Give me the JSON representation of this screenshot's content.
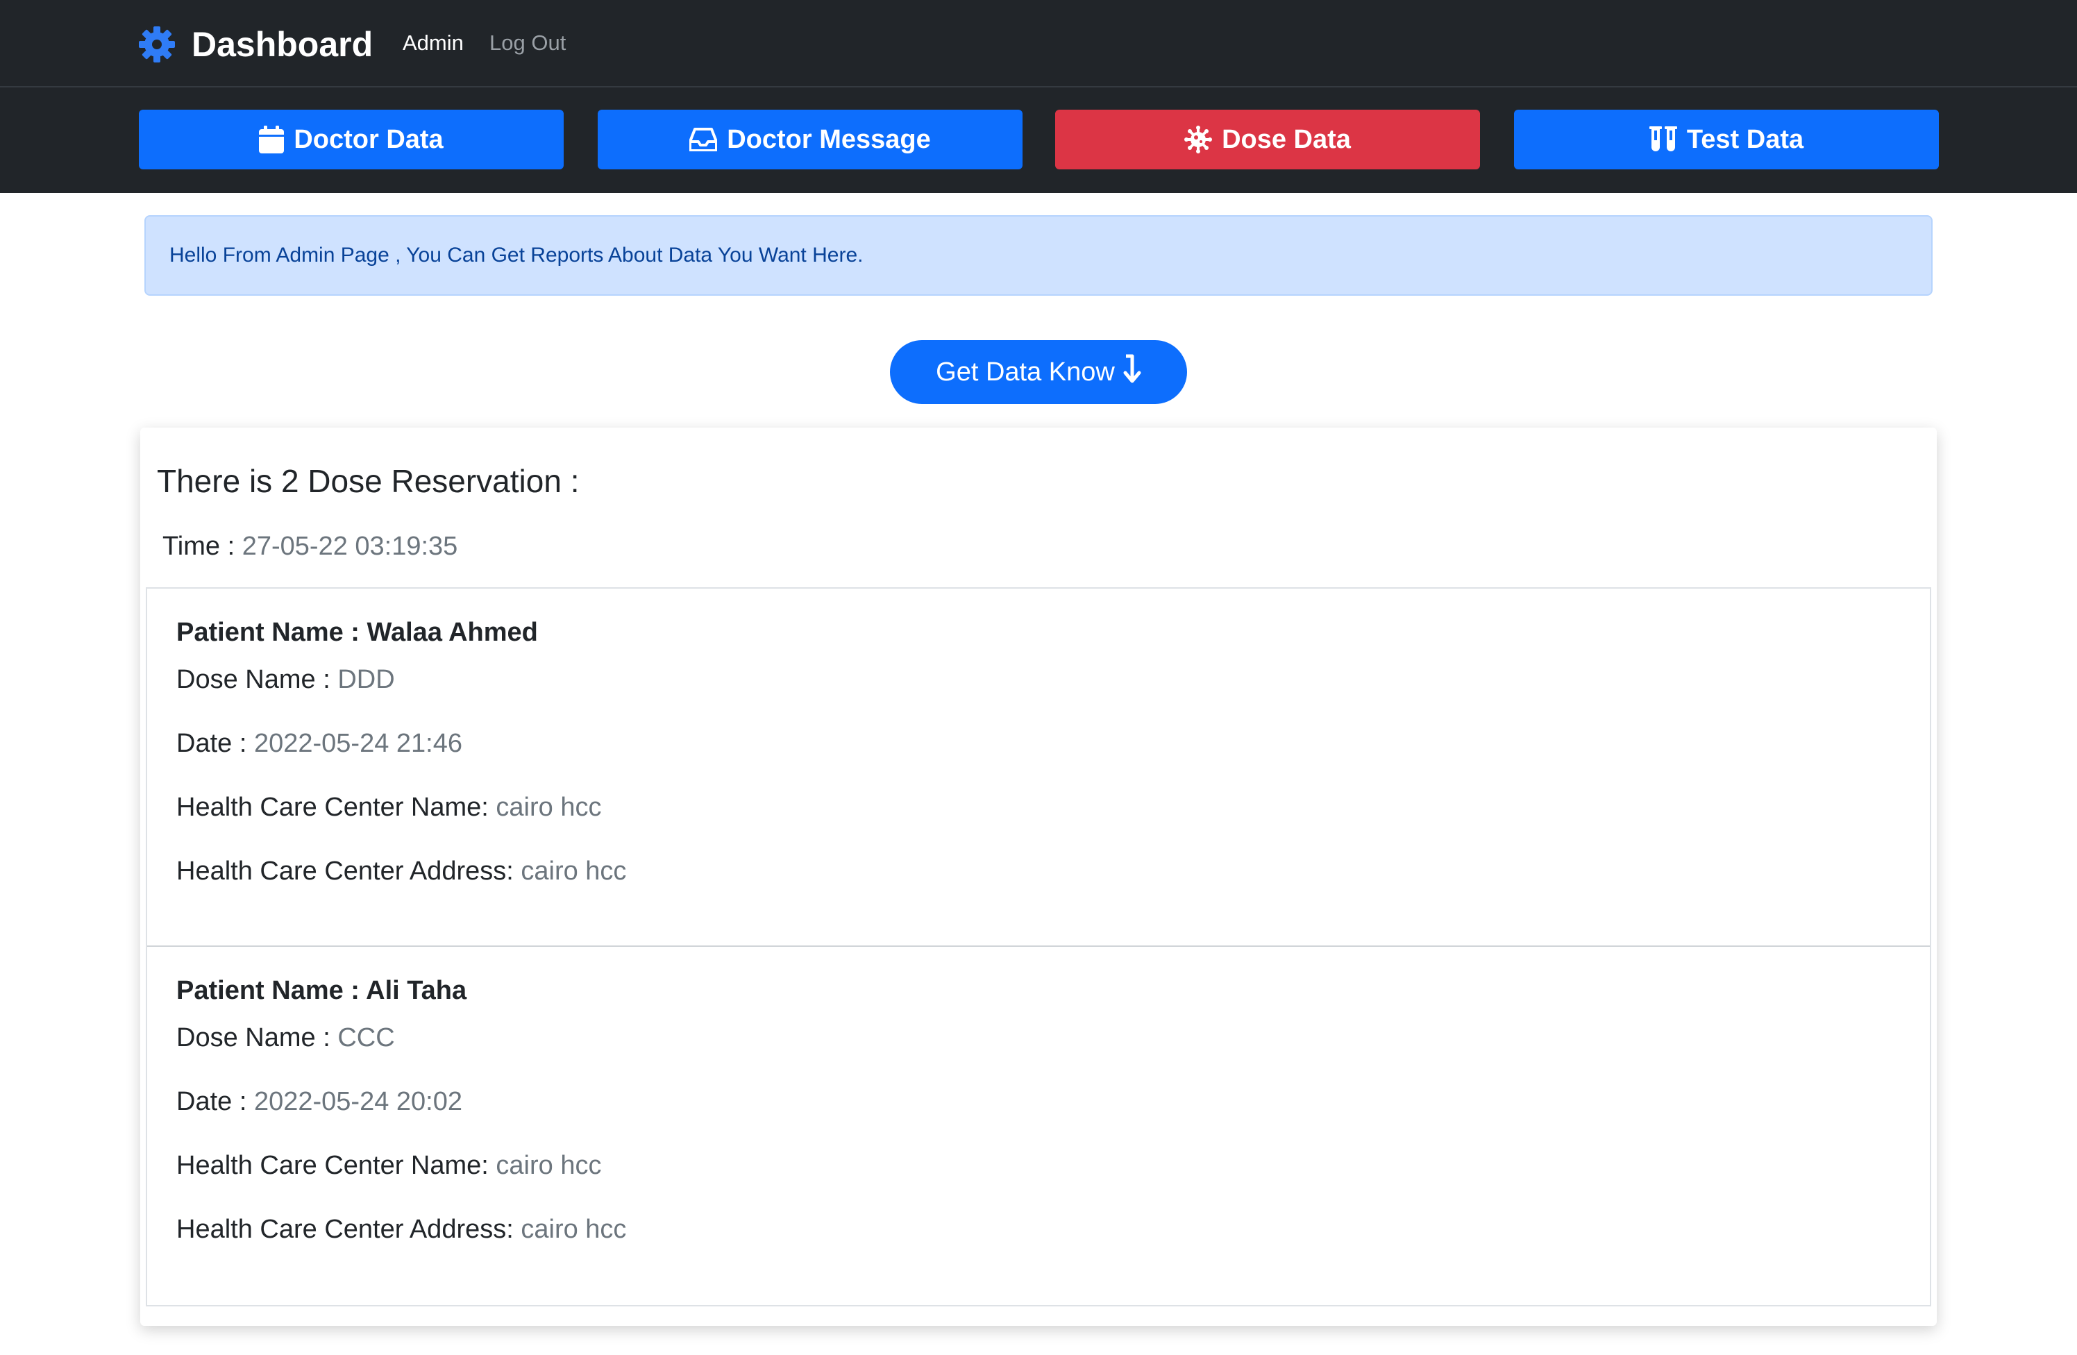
{
  "navbar": {
    "brand": "Dashboard",
    "brand_icon": "gear-icon",
    "links": [
      {
        "label": "Admin",
        "active": true
      },
      {
        "label": "Log Out",
        "active": false
      }
    ]
  },
  "actions": [
    {
      "label": "Doctor Data",
      "icon": "calendar-icon",
      "color": "#0d6efd"
    },
    {
      "label": "Doctor Message",
      "icon": "inbox-icon",
      "color": "#0d6efd"
    },
    {
      "label": "Dose Data",
      "icon": "virus-icon",
      "color": "#dc3545",
      "active": true
    },
    {
      "label": "Test Data",
      "icon": "test-tubes-icon",
      "color": "#0d6efd"
    }
  ],
  "alert": {
    "text": "Hello From Admin Page , You Can Get Reports About Data You Want Here."
  },
  "get_data": {
    "label": "Get Data Know",
    "icon": "arrow-down-icon"
  },
  "report": {
    "title": "There is 2 Dose Reservation :",
    "time_label": "Time :",
    "time_value": "27-05-22 03:19:35",
    "items": [
      {
        "patient_label": "Patient Name :",
        "patient_name": "Walaa Ahmed",
        "dose_label": "Dose Name :",
        "dose_name": "DDD",
        "date_label": "Date :",
        "date": "2022-05-24 21:46",
        "hcc_name_label": "Health Care Center Name:",
        "hcc_name": "cairo hcc",
        "hcc_address_label": "Health Care Center Address:",
        "hcc_address": "cairo hcc"
      },
      {
        "patient_label": "Patient Name :",
        "patient_name": "Ali Taha",
        "dose_label": "Dose Name :",
        "dose_name": "CCC",
        "date_label": "Date :",
        "date": "2022-05-24 20:02",
        "hcc_name_label": "Health Care Center Name:",
        "hcc_name": "cairo hcc",
        "hcc_address_label": "Health Care Center Address:",
        "hcc_address": "cairo hcc"
      }
    ]
  },
  "colors": {
    "navbar_bg": "#212529",
    "primary": "#0d6efd",
    "danger": "#dc3545",
    "alert_bg": "#cfe2ff"
  }
}
